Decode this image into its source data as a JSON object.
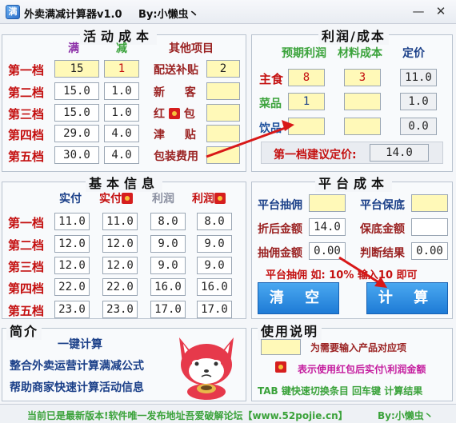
{
  "titlebar": {
    "icon": "满",
    "title": "外卖满减计算器v1.0",
    "by": "By:小懒虫丶",
    "minimize": "—",
    "close": "✕"
  },
  "activity": {
    "title": "活动成本",
    "col_full": "满",
    "col_minus": "减",
    "col_other": "其他项目",
    "tiers": [
      {
        "label": "第一档",
        "full": "15",
        "minus": "1"
      },
      {
        "label": "第二档",
        "full": "15.0",
        "minus": "1.0"
      },
      {
        "label": "第三档",
        "full": "15.0",
        "minus": "1.0"
      },
      {
        "label": "第四档",
        "full": "29.0",
        "minus": "4.0"
      },
      {
        "label": "第五档",
        "full": "30.0",
        "minus": "4.0"
      }
    ],
    "other": [
      {
        "label": "配送补贴",
        "value": "2"
      },
      {
        "label": "新 客",
        "value": ""
      },
      {
        "label_a": "红",
        "label_b": "包",
        "value": ""
      },
      {
        "label": "津 贴",
        "value": ""
      },
      {
        "label": "包装费用",
        "value": ""
      }
    ]
  },
  "profit": {
    "title": "利润/成本",
    "col_expected": "预期利润",
    "col_material": "材料成本",
    "col_price": "定价",
    "rows": [
      {
        "label": "主食",
        "expected": "8",
        "material": "3",
        "price": "11.0"
      },
      {
        "label": "菜品",
        "expected": "1",
        "material": "",
        "price": "1.0"
      },
      {
        "label": "饮品",
        "expected": "",
        "material": "",
        "price": "0.0"
      }
    ],
    "suggest_label": "第一档建议定价:",
    "suggest_value": "14.0"
  },
  "basic": {
    "title": "基本信息",
    "col_paid": "实付",
    "col_paid_red": "实付",
    "col_profit": "利润",
    "col_profit_red": "利润",
    "rows": [
      {
        "label": "第一档",
        "paid": "11.0",
        "paid_red": "11.0",
        "profit": "8.0",
        "profit_red": "8.0"
      },
      {
        "label": "第二档",
        "paid": "12.0",
        "paid_red": "12.0",
        "profit": "9.0",
        "profit_red": "9.0"
      },
      {
        "label": "第三档",
        "paid": "12.0",
        "paid_red": "12.0",
        "profit": "9.0",
        "profit_red": "9.0"
      },
      {
        "label": "第四档",
        "paid": "22.0",
        "paid_red": "22.0",
        "profit": "16.0",
        "profit_red": "16.0"
      },
      {
        "label": "第五档",
        "paid": "23.0",
        "paid_red": "23.0",
        "profit": "17.0",
        "profit_red": "17.0"
      }
    ]
  },
  "platform": {
    "title": "平台成本",
    "commission_label": "平台抽佣",
    "commission_value": "",
    "guarantee_label": "平台保底",
    "guarantee_value": "",
    "discounted_label": "折后金额",
    "discounted_value": "14.0",
    "guarantee_amount_label": "保底金额",
    "guarantee_amount_value": "",
    "commission_amount_label": "抽佣金额",
    "commission_amount_value": "0.00",
    "judge_label": "判断结果",
    "judge_value": "0.00",
    "hint": "平台抽佣 如: 10% 输入10 即可",
    "clear_button": "清 空",
    "calc_button": "计 算"
  },
  "intro": {
    "title": "简介",
    "line1": "一键计算",
    "line2": "整合外卖运营计算满减公式",
    "line3": "帮助商家快速计算活动信息"
  },
  "usage": {
    "title": "使用说明",
    "yellow_desc": "为需要输入产品对应项",
    "red_desc": "表示使用红包后实付\\利润金额",
    "keys": "TAB 键快速切换条目 回车键 计算结果"
  },
  "status": {
    "text": "当前已是最新版本!软件唯一发布地址吾爱破解论坛【www.52pojie.cn】",
    "by": "By:小懒虫丶"
  },
  "colors": {
    "accent_red": "#c41010",
    "input_yellow": "#fff9b8",
    "button_blue": "#1e7bd6"
  }
}
